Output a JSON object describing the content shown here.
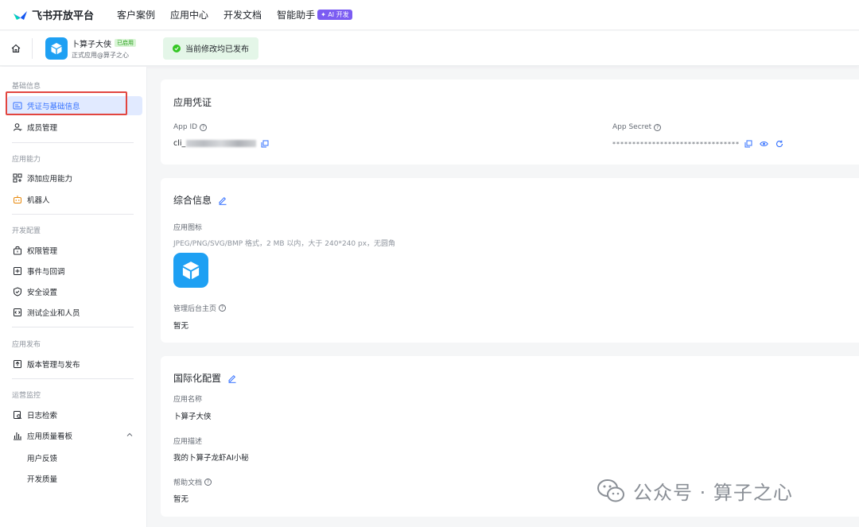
{
  "topnav": {
    "brand": "飞书开放平台",
    "links": [
      "客户案例",
      "应用中心",
      "开发文档",
      "智能助手"
    ],
    "ai_badge": "✦ AI 开发"
  },
  "app": {
    "name": "卜算子大侠",
    "status_badge": "已启用",
    "subtitle": "正式应用@算子之心",
    "publish_status": "当前修改均已发布"
  },
  "sidebar": {
    "sections": [
      {
        "title": "基础信息",
        "items": [
          "凭证与基础信息",
          "成员管理"
        ]
      },
      {
        "title": "应用能力",
        "items": [
          "添加应用能力",
          "机器人"
        ]
      },
      {
        "title": "开发配置",
        "items": [
          "权限管理",
          "事件与回调",
          "安全设置",
          "测试企业和人员"
        ]
      },
      {
        "title": "应用发布",
        "items": [
          "版本管理与发布"
        ]
      },
      {
        "title": "运营监控",
        "items": [
          "日志检索",
          "应用质量看板"
        ]
      }
    ],
    "sub_items": [
      "用户反馈",
      "开发质量"
    ],
    "active": "凭证与基础信息"
  },
  "credentials": {
    "title": "应用凭证",
    "app_id_label": "App ID",
    "app_id_value": "cli_",
    "app_secret_label": "App Secret",
    "app_secret_value": "********************************"
  },
  "general": {
    "title": "综合信息",
    "icon_label": "应用图标",
    "icon_hint": "JPEG/PNG/SVG/BMP 格式，2 MB 以内，大于 240*240 px，无圆角",
    "admin_label": "管理后台主页",
    "admin_value": "暂无"
  },
  "i18n": {
    "title": "国际化配置",
    "name_label": "应用名称",
    "name_value": "卜算子大侠",
    "desc_label": "应用描述",
    "desc_value": "我的卜算子龙虾AI小秘",
    "help_label": "帮助文档",
    "help_value": "暂无"
  },
  "watermark": "公众号 · 算子之心",
  "colors": {
    "accent": "#3370ff",
    "success_bg": "#e4f6e8",
    "highlight": "#e2453f",
    "app_icon": "#1ea0f3"
  }
}
